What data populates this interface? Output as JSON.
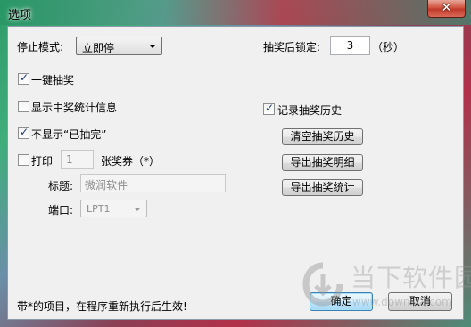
{
  "window": {
    "title": "选项",
    "close_glyph": "✕"
  },
  "stop_mode": {
    "label": "停止模式:",
    "selected": "立即停"
  },
  "lock": {
    "label": "抽奖后锁定:",
    "value": "3",
    "unit": "（秒）"
  },
  "options": {
    "one_click": {
      "label": "一键抽奖",
      "checked": true
    },
    "show_stats": {
      "label": "显示中奖统计信息",
      "checked": false
    },
    "hide_done": {
      "label": "不显示“已抽完”",
      "checked": true
    },
    "record_history": {
      "label": "记录抽奖历史",
      "checked": true
    }
  },
  "print": {
    "label": "打印",
    "checked": false,
    "count": "1",
    "suffix": "张奖券（*）",
    "title_label": "标题:",
    "title_value": "微润软件",
    "port_label": "端口:",
    "port_value": "LPT1"
  },
  "buttons": {
    "clear_history": "清空抽奖历史",
    "export_detail": "导出抽奖明细",
    "export_stats": "导出抽奖统计",
    "ok": "确定",
    "cancel": "取消"
  },
  "footer_note": "带*的项目，在程序重新执行后生效!",
  "watermark": {
    "name": "当下软件园",
    "url": "www.downxia.com"
  },
  "colors": {
    "accent_blue": "#3c7fb1",
    "close_red": "#c0392b",
    "dialog_bg": "#f0f0f0"
  }
}
